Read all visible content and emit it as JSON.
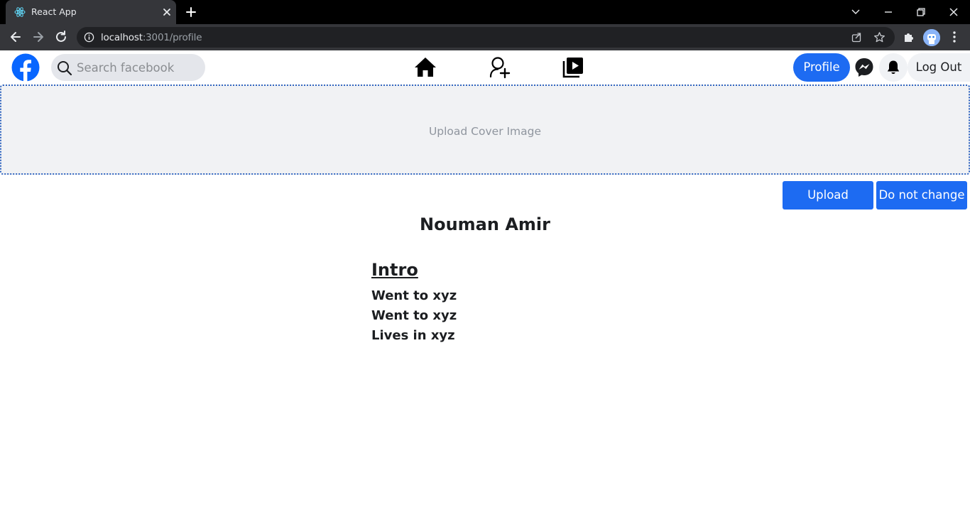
{
  "browser": {
    "tab_title": "React App",
    "url_host": "localhost",
    "url_rest": ":3001/profile"
  },
  "navbar": {
    "search_placeholder": "Search facebook",
    "profile_label": "Profile",
    "logout_label": "Log Out",
    "brand_color": "#1d6bf2"
  },
  "cover": {
    "label": "Upload Cover Image"
  },
  "actions": {
    "upload_label": "Upload",
    "no_change_label": "Do not change"
  },
  "profile": {
    "name": "Nouman Amir"
  },
  "intro": {
    "title": "Intro",
    "items": [
      "Went to xyz",
      "Went to xyz",
      "Lives in xyz"
    ]
  },
  "icons": [
    "react-icon",
    "close-icon",
    "plus-icon",
    "back-icon",
    "forward-icon",
    "reload-icon",
    "info-icon",
    "share-icon",
    "star-icon",
    "extensions-icon",
    "profile-avatar-icon",
    "menu-dots-icon",
    "facebook-logo-icon",
    "search-icon",
    "home-icon",
    "friends-icon",
    "video-icon",
    "messenger-icon",
    "bell-icon"
  ]
}
